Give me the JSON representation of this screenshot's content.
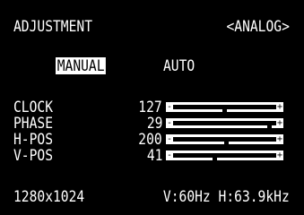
{
  "header": {
    "title": "ADJUSTMENT",
    "input": "<ANALOG>"
  },
  "modes": {
    "manual": "MANUAL",
    "auto": "AUTO",
    "selected": "MANUAL"
  },
  "bar_symbols": {
    "minus": "-",
    "plus": "+"
  },
  "settings": [
    {
      "label": "CLOCK",
      "value": "127",
      "level": 0.5
    },
    {
      "label": "PHASE",
      "value": "29",
      "level": 0.95
    },
    {
      "label": "H-POS",
      "value": "200",
      "level": 0.52
    },
    {
      "label": "V-POS",
      "value": "41",
      "level": 0.4
    }
  ],
  "status": {
    "resolution": "1280x1024",
    "frequency": "V:60Hz H:63.9kHz"
  }
}
